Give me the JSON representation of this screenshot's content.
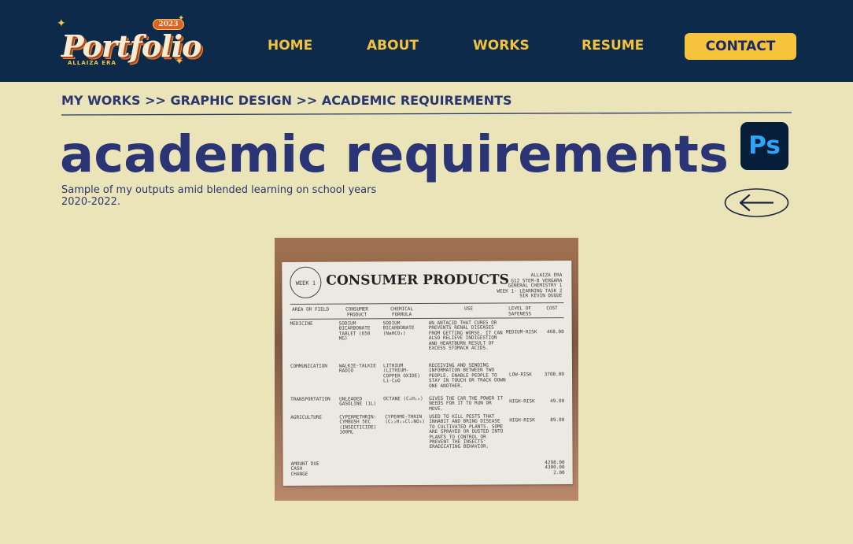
{
  "nav": {
    "logo": {
      "text": "Portfolio",
      "subtitle": "ALLAIZA ERA",
      "year": "2023"
    },
    "links": {
      "home": "HOME",
      "about": "ABOUT",
      "works": "WORKS",
      "resume": "RESUME"
    },
    "contact_label": "CONTACT",
    "colors": {
      "background": "#0e2a4a",
      "link": "#f3c23a",
      "contact_button": "#f5c43c"
    }
  },
  "breadcrumb": "MY WORKS >> GRAPHIC DESIGN >> ACADEMIC REQUIREMENTS",
  "page": {
    "title": "academic requirements",
    "description": "Sample of my outputs amid blended learning on school years 2020-2022.",
    "tool_icon": {
      "name": "photoshop-icon",
      "label": "Ps"
    },
    "back_icon": "arrow-left-icon",
    "colors": {
      "background": "#ebe4b8",
      "title": "#2b3575"
    }
  },
  "artwork": {
    "week_badge": "WEEK 1",
    "title": "CONSUMER PRODUCTS",
    "meta": [
      "ALLAIZA ERA",
      "G12 STEM-B VERGARA",
      "GENERAL CHEMISTRY 1",
      "WEEK 1- LEARNING TASK 2",
      "SIR KEVIN DUQUE"
    ],
    "headers": [
      "AREA OR FIELD",
      "CONSUMER PRODUCT",
      "CHEMICAL FORMULA",
      "USE",
      "LEVEL OF SAFENESS",
      "COST"
    ],
    "rows": [
      {
        "area": "MEDICINE",
        "product": "SODIUM BICARBONATE TABLET (650 MG)",
        "formula": "SODIUM BICARBONATE (NaHCO₃)",
        "use": "AN ANTACID THAT CURES OR PREVENTS RENAL DISEASES FROM GETTING WORSE. IT CAN ALSO RELIEVE INDIGESTION AND HEARTBURN RESULT OF EXCESS STOMACH ACIDS.",
        "level": "MEDIUM-RISK",
        "cost": "468.00"
      },
      {
        "area": "COMMUNICATION",
        "product": "WALKIE-TALKIE RADIO",
        "formula": "LITHIUM (LITHIUM-COPPER OXIDE) Li-CuO",
        "use": "RECEIVING AND SENDING INFORMATION BETWEEN TWO PEOPLE. ENABLE PEOPLE TO STAY IN TOUCH OR TRACK DOWN ONE ANOTHER.",
        "level": "LOW-RISK",
        "cost": "3708.00"
      },
      {
        "area": "TRANSPORTATION",
        "product": "UNLEADED GASOLINE (1L)",
        "formula": "OCTANE (C₈H₁₈)",
        "use": "GIVES THE CAR THE POWER IT NEEDS FOR IT TO RUN OR MOVE.",
        "level": "HIGH-RISK",
        "cost": "49.00"
      },
      {
        "area": "AGRICULTURE",
        "product": "CYPERMETHRIN: CYMBUSH 5EC (INSECTICIDE) 100ML",
        "formula": "CYPERME-THRIN (C₂₂H₁₉Cl₂NO₃)",
        "use": "USED TO KILL PESTS THAT INHABIT AND BRING DISEASE TO CULTIVATED PLANTS. SOME ARE SPRAYED OR DUSTED INTO PLANTS TO CONTROL OR PREVENT THE INSECTS' ERADICATING BEHAVIOR.",
        "level": "HIGH-RISK",
        "cost": "89.00"
      }
    ],
    "totals": [
      {
        "label": "AMOUNT DUE",
        "value": "4298.00"
      },
      {
        "label": "CASH",
        "value": "4300.00"
      },
      {
        "label": "CHANGE",
        "value": "2.00"
      }
    ]
  }
}
